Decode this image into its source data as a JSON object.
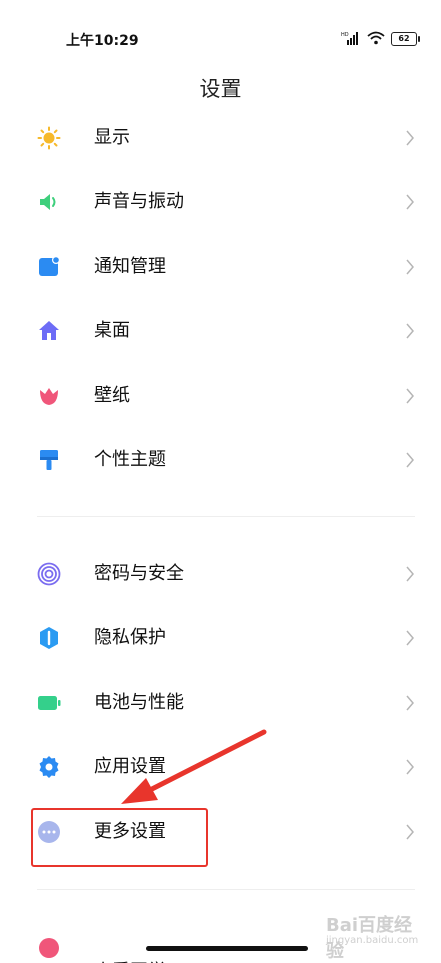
{
  "status_bar": {
    "time": "上午10:29",
    "battery": "62",
    "network_label": "HD",
    "icons": [
      "signal-icon",
      "wifi-icon",
      "battery-icon"
    ]
  },
  "header": {
    "title": "设置"
  },
  "settings": {
    "group1": [
      {
        "label": "显示",
        "icon": "sun-icon",
        "color": "#f6b92b"
      },
      {
        "label": "声音与振动",
        "icon": "speaker-icon",
        "color": "#3ecf7c"
      },
      {
        "label": "通知管理",
        "icon": "notification-icon",
        "color": "#2b8bf2"
      },
      {
        "label": "桌面",
        "icon": "home-icon",
        "color": "#6d6cf6"
      },
      {
        "label": "壁纸",
        "icon": "tulip-icon",
        "color": "#f0567a"
      },
      {
        "label": "个性主题",
        "icon": "paintbrush-icon",
        "color": "#2b8bf2"
      }
    ],
    "group2": [
      {
        "label": "密码与安全",
        "icon": "fingerprint-icon",
        "color": "#7a6cf0"
      },
      {
        "label": "隐私保护",
        "icon": "shield-icon",
        "color": "#2b9bf2"
      },
      {
        "label": "电池与性能",
        "icon": "battery-icon",
        "color": "#34d08b"
      },
      {
        "label": "应用设置",
        "icon": "gear-icon",
        "color": "#2b8bf2"
      },
      {
        "label": "更多设置",
        "icon": "more-icon",
        "color": "#a8b6ec"
      }
    ],
    "group3_partial": [
      {
        "label": "小爱同学",
        "icon": "partial-icon",
        "color": "#f0567a"
      }
    ]
  },
  "annotations": {
    "highlight_color": "#e8352c",
    "highlighted_item": "更多设置"
  },
  "watermark": {
    "main": "Bai百度经验",
    "sub": "jingyan.baidu.com"
  }
}
